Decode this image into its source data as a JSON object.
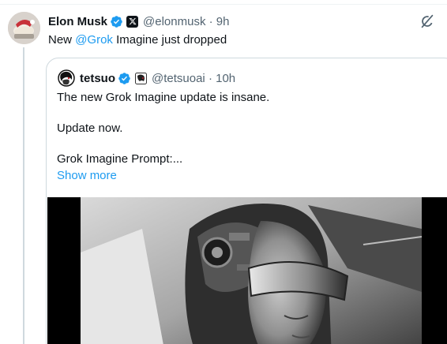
{
  "tweet": {
    "author_name": "Elon Musk",
    "handle": "@elonmusk",
    "separator": "·",
    "time": "9h",
    "text_prefix": "New ",
    "mention": "@Grok",
    "text_suffix": " Imagine just dropped"
  },
  "quote": {
    "author_name": "tetsuo",
    "handle": "@tetsuoai",
    "separator": "·",
    "time": "10h",
    "lines": [
      "The new Grok Imagine update is insane.",
      "Update now.",
      "Grok Imagine Prompt:..."
    ],
    "show_more": "Show more"
  },
  "icons": {
    "verified": "verified-badge-icon",
    "x_affiliate": "x-logo-icon",
    "grok": "grok-icon",
    "quote_affiliate": "avatar-badge-icon"
  },
  "colors": {
    "verified_blue": "#1d9bf0",
    "link_blue": "#1d9bf0",
    "text": "#0f1419",
    "secondary_text": "#536471",
    "border": "#cfd9de"
  }
}
